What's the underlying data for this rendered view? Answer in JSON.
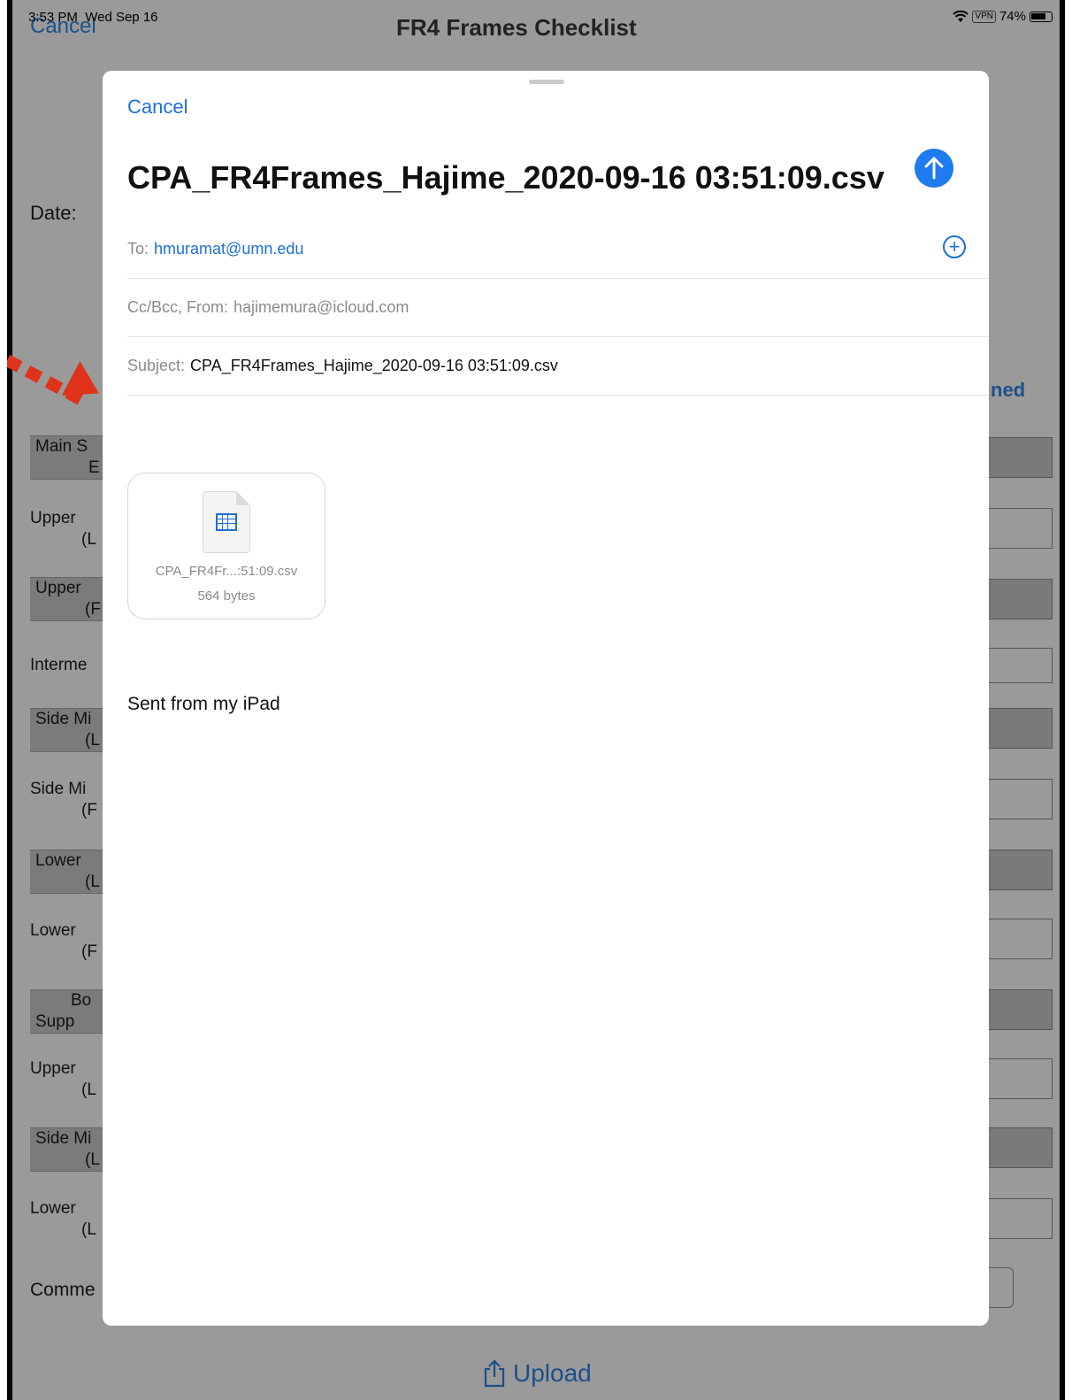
{
  "status_bar": {
    "time": "3:53 PM",
    "date": "Wed Sep 16",
    "vpn": "VPN",
    "battery": "74%"
  },
  "background": {
    "cancel": "Cancel",
    "title": "FR4 Frames Checklist",
    "date_label": "Date:",
    "edge_text": "ned",
    "rows": [
      {
        "line1": "Main S",
        "line2": "E",
        "shaded": true
      },
      {
        "line1": "Upper",
        "line2": "(L",
        "shaded": false
      },
      {
        "line1": "Upper",
        "line2": "(F",
        "shaded": true
      },
      {
        "line1": "Interme",
        "line2": "",
        "shaded": false
      },
      {
        "line1": "Side Mi",
        "line2": "(L",
        "shaded": true
      },
      {
        "line1": "Side Mi",
        "line2": "(F",
        "shaded": false
      },
      {
        "line1": "Lower",
        "line2": "(L",
        "shaded": true
      },
      {
        "line1": "Lower",
        "line2": "(F",
        "shaded": false
      },
      {
        "line1": "Bo",
        "line2": "Supp",
        "shaded": true
      },
      {
        "line1": "Upper",
        "line2": "(L",
        "shaded": false
      },
      {
        "line1": "Side Mi",
        "line2": "(L",
        "shaded": true
      },
      {
        "line1": "Lower",
        "line2": "(L",
        "shaded": false
      },
      {
        "line1": "Comme",
        "line2": "",
        "shaded": false
      }
    ],
    "upload_label": "Upload"
  },
  "compose": {
    "cancel_label": "Cancel",
    "subject_title": "CPA_FR4Frames_Hajime_2020-09-16 03:51:09.csv",
    "to_label": "To:",
    "to_value": "hmuramat@umn.edu",
    "ccbcc_label": "Cc/Bcc, From:",
    "from_value": "hajimemura@icloud.com",
    "subject_label": "Subject:",
    "subject_value": "CPA_FR4Frames_Hajime_2020-09-16 03:51:09.csv",
    "attachment": {
      "name": "CPA_FR4Fr...:51:09.csv",
      "size": "564 bytes"
    },
    "signature": "Sent from my iPad"
  },
  "colors": {
    "accent": "#1e70d6",
    "send_button": "#1e7bf0",
    "annotation_arrow": "#e0331b"
  }
}
